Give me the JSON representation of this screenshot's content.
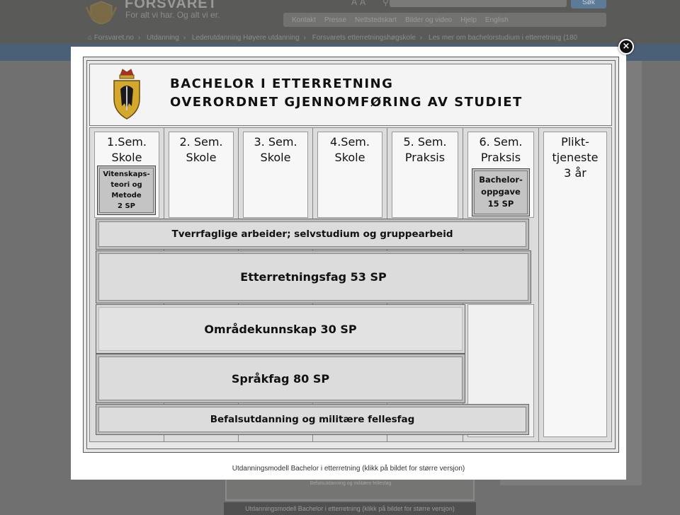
{
  "site": {
    "title": "FORSVARET",
    "tagline": "For alt vi har. Og alt vi er.",
    "text_size_label": "A A",
    "search_button": "Søk",
    "util_links": [
      "Kontakt",
      "Presse",
      "Nettstedskart",
      "Bilder og video",
      "Hjelp",
      "English"
    ],
    "breadcrumb": [
      "Forsvaret.no",
      "Utdanning",
      "Lederutdanning Høyere utdanning",
      "Forsvarets etterretningshøgskole",
      "Les mer om bachelorstudium i etterretning (180"
    ]
  },
  "lightbox": {
    "close_label": "×",
    "caption": "Utdanningsmodell Bachelor i etterretning (klikk på bildet for større versjon)"
  },
  "diagram": {
    "title_line1": "BACHELOR I ETTERRETNING",
    "title_line2": "OVERORDNET GJENNOMFØRING AV STUDIET",
    "columns": [
      {
        "line1": "1.Sem.",
        "line2": "Skole"
      },
      {
        "line1": "2. Sem.",
        "line2": "Skole"
      },
      {
        "line1": "3. Sem.",
        "line2": "Skole"
      },
      {
        "line1": "4.Sem.",
        "line2": "Skole"
      },
      {
        "line1": "5. Sem.",
        "line2": "Praksis"
      },
      {
        "line1": "6. Sem.",
        "line2": "Praksis"
      },
      {
        "line1": "Plikt-",
        "line2": "tjeneste",
        "line3": "3 år"
      }
    ],
    "box_vitenskap": [
      "Vitenskaps-",
      "teori og",
      "Metode",
      "2 SP"
    ],
    "box_bachelor": [
      "Bachelor-",
      "oppgave",
      "15 SP"
    ],
    "bars": {
      "tverrfaglige": "Tverrfaglige arbeider; selvstudium og gruppearbeid",
      "etterretningsfag": "Etterretningsfag 53 SP",
      "omradekunnskap": "Områdekunnskap 30 SP",
      "sprakfag": "Språkfag 80 SP",
      "befal": "Befalsutdanning og militære fellesfag"
    }
  },
  "background": {
    "thumb_text": "Befalsutdanning og militære fellesfag",
    "caption": "Utdanningsmodell Bachelor i etterretning (klikk på bildet for større versjon)"
  },
  "colors": {
    "bluebar": "#4a6077",
    "diagram_bg": "#e7e7e7",
    "bar_fill": "#dcdcdc"
  }
}
